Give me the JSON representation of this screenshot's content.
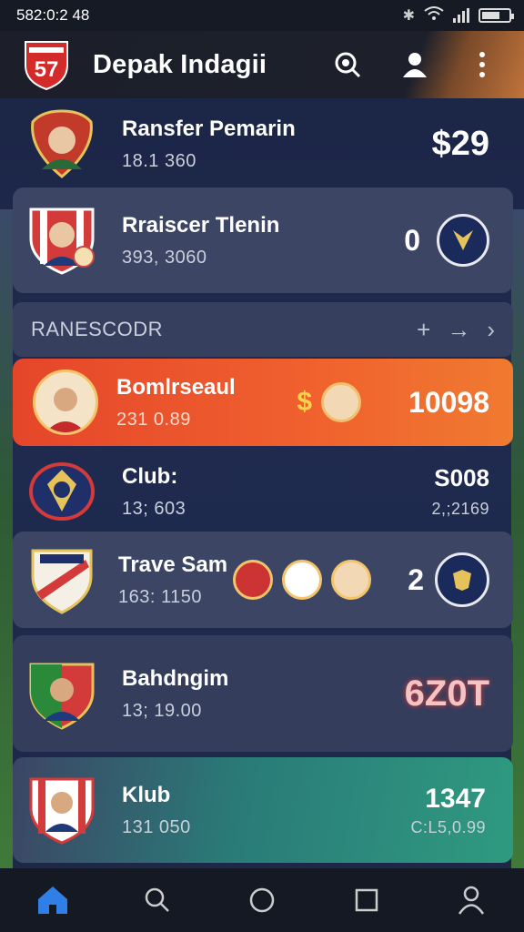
{
  "status": {
    "time": "582:0:2 48"
  },
  "app": {
    "title": "Depak Indagii"
  },
  "section": {
    "label": "RANESCODR",
    "add": "+",
    "arrow": "→",
    "chevron": "›"
  },
  "rows": [
    {
      "name": "Ransfer Pemarin",
      "sub": "18.1 360",
      "value": "$29"
    },
    {
      "name": "Rraiscer Tlenin",
      "sub": "393, 3060",
      "value": "0"
    },
    {
      "name": "Bomlrseaul",
      "sub": "231 0.89",
      "currency": "$",
      "value": "10098"
    },
    {
      "name": "Club:",
      "sub": "13; 603",
      "value": "S008",
      "value_sub": "2,;2169"
    },
    {
      "name": "Trave Sam",
      "sub": "163: 1150",
      "value": "2"
    },
    {
      "name": "Bahdngim",
      "sub": "13; 19.00",
      "value": "6Z0T"
    },
    {
      "name": "Klub",
      "sub": "131 050",
      "value": "1347",
      "value_sub": "C:L5,0.99"
    }
  ],
  "colors": {
    "highlight": "#e8512a",
    "teal": "#2e8f7e",
    "card": "#3c4564",
    "value_red": "#f3c4c4"
  }
}
